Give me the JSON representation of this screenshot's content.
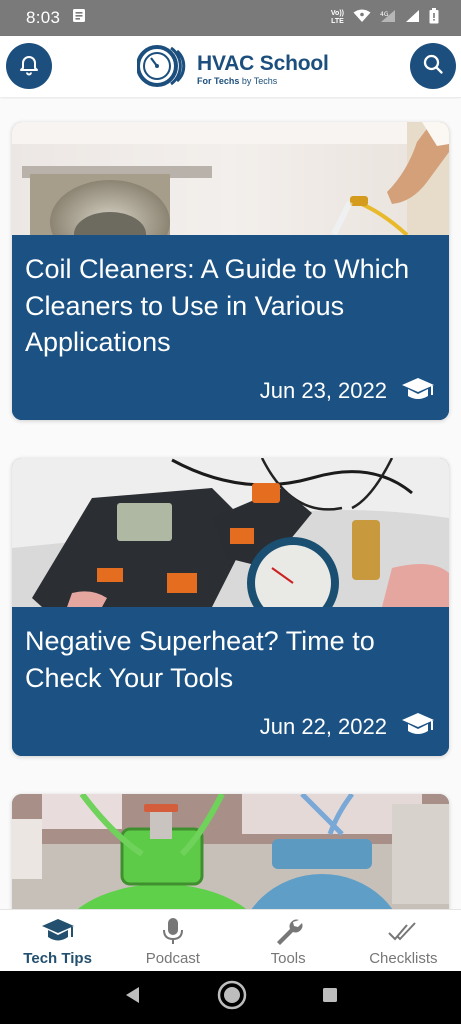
{
  "status_bar": {
    "time": "8:03",
    "lte_line1": "Vo))",
    "lte_line2": "LTE"
  },
  "header": {
    "logo_title": "HVAC School",
    "logo_sub_prefix": "For Techs",
    "logo_sub_suffix": " by Techs"
  },
  "articles": [
    {
      "title": "Coil Cleaners: A Guide to Which Cleaners to Use in Various Applications",
      "date": "Jun 23, 2022",
      "icon": "graduation-cap-icon"
    },
    {
      "title": "Negative Superheat? Time to Check Your Tools",
      "date": "Jun 22, 2022",
      "icon": "graduation-cap-icon"
    }
  ],
  "bottom_nav": {
    "items": [
      {
        "label": "Tech Tips",
        "icon": "graduation-cap-icon",
        "active": true
      },
      {
        "label": "Podcast",
        "icon": "microphone-icon",
        "active": false
      },
      {
        "label": "Tools",
        "icon": "wrench-icon",
        "active": false
      },
      {
        "label": "Checklists",
        "icon": "double-check-icon",
        "active": false
      }
    ]
  },
  "colors": {
    "brand": "#1c4f7d",
    "card_overlay": "#1b5283",
    "status_bar": "#7a7a7a"
  }
}
